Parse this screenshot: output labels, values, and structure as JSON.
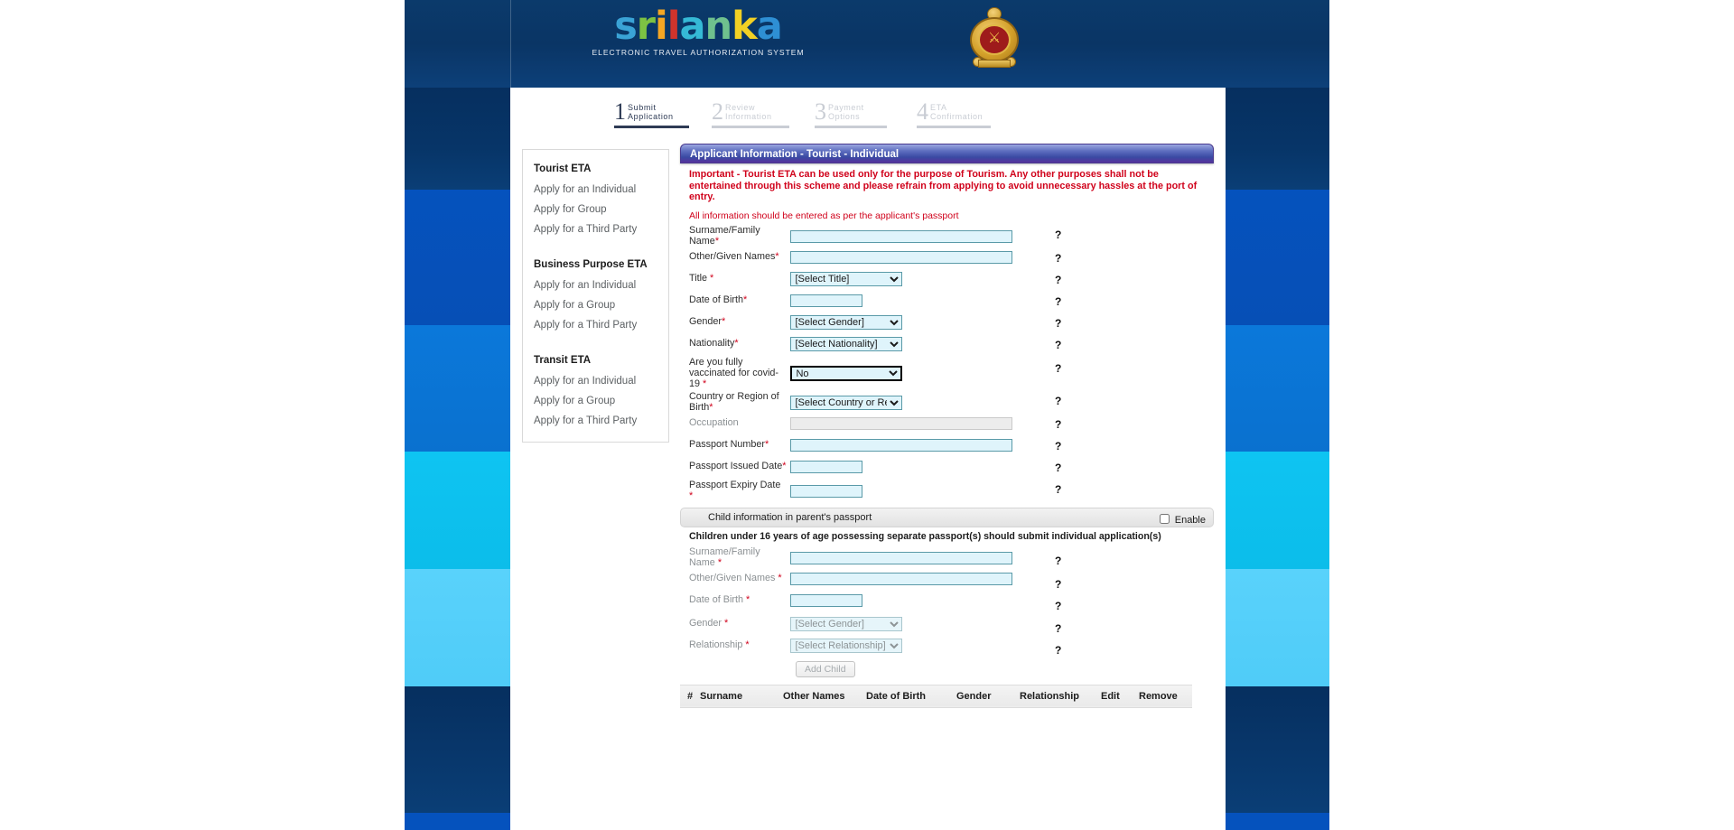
{
  "brand": {
    "word_parts": [
      "s",
      "r",
      "i",
      "l",
      "a",
      "n",
      "k",
      "a"
    ],
    "subtitle": "ELECTRONIC TRAVEL AUTHORIZATION SYSTEM",
    "emblem_name": "sri-lanka-national-emblem",
    "accent_purple": "#56329c",
    "accent_red": "#d0021b",
    "input_fill": "#dff4fb"
  },
  "steps": [
    {
      "num": "1",
      "line1": "Submit",
      "line2": "Application",
      "state": "active"
    },
    {
      "num": "2",
      "line1": "Review",
      "line2": "Information",
      "state": "idle"
    },
    {
      "num": "3",
      "line1": "Payment",
      "line2": "Options",
      "state": "idle"
    },
    {
      "num": "4",
      "line1": "ETA",
      "line2": "Confirmation",
      "state": "idle"
    }
  ],
  "sidebar": {
    "groups": [
      {
        "title": "Tourist ETA",
        "links": [
          "Apply for an Individual",
          "Apply for Group",
          "Apply for a Third Party"
        ]
      },
      {
        "title": "Business Purpose ETA",
        "links": [
          "Apply for an Individual",
          "Apply for a Group",
          "Apply for a Third Party"
        ]
      },
      {
        "title": "Transit ETA",
        "links": [
          "Apply for an Individual",
          "Apply for a Group",
          "Apply for a Third Party"
        ]
      }
    ]
  },
  "form": {
    "title": "Applicant Information - Tourist - Individual",
    "notice": "Important - Tourist ETA can be used only for the purpose of Tourism. Any other purposes shall not be entertained through this scheme and please refrain from applying to avoid unnecessary hassles at the port of entry.",
    "subnotice": "All information should be entered as per the applicant's passport",
    "help_glyph": "?",
    "fields": {
      "surname": {
        "label": "Surname/Family Name",
        "req": "*",
        "value": ""
      },
      "given_names": {
        "label": "Other/Given Names",
        "req": "*",
        "value": ""
      },
      "title": {
        "label": "Title ",
        "req": "*",
        "value": "[Select Title]"
      },
      "dob": {
        "label": "Date of Birth",
        "req": "*",
        "value": ""
      },
      "gender": {
        "label": "Gender",
        "req": "*",
        "value": "[Select Gender]"
      },
      "nationality": {
        "label": "Nationality",
        "req": "*",
        "value": "[Select Nationality]"
      },
      "vaccinated": {
        "label": "Are you fully vaccinated for covid-19 ",
        "req": "*",
        "value": "No"
      },
      "country_birth": {
        "label": "Country or Region of Birth",
        "req": "*",
        "value": "[Select Country or Region"
      },
      "occupation": {
        "label": "Occupation",
        "req": "",
        "value": ""
      },
      "passport_no": {
        "label": "Passport Number",
        "req": "*",
        "value": ""
      },
      "passport_issue": {
        "label": "Passport Issued Date",
        "req": "*",
        "value": ""
      },
      "passport_expiry": {
        "label": "Passport Expiry Date ",
        "req": "*",
        "value": ""
      }
    }
  },
  "child": {
    "bar_title": "Child information in parent's passport",
    "enable_label": "Enable",
    "enable_checked": false,
    "note": "Children under 16 years of age possessing separate passport(s) should submit individual application(s)",
    "fields": {
      "surname": {
        "label": "Surname/Family Name ",
        "req": "*",
        "value": ""
      },
      "given_names": {
        "label": "Other/Given Names ",
        "req": "*",
        "value": ""
      },
      "dob": {
        "label": "Date of Birth ",
        "req": "*",
        "value": ""
      },
      "gender": {
        "label": "Gender ",
        "req": "*",
        "value": "[Select Gender]"
      },
      "relationship": {
        "label": "Relationship ",
        "req": "*",
        "value": "[Select Relationship]"
      }
    },
    "add_button": "Add Child",
    "table": {
      "headers": [
        "#",
        "Surname",
        "Other Names",
        "Date of Birth",
        "Gender",
        "Relationship",
        "Edit",
        "Remove"
      ],
      "rows": []
    }
  }
}
